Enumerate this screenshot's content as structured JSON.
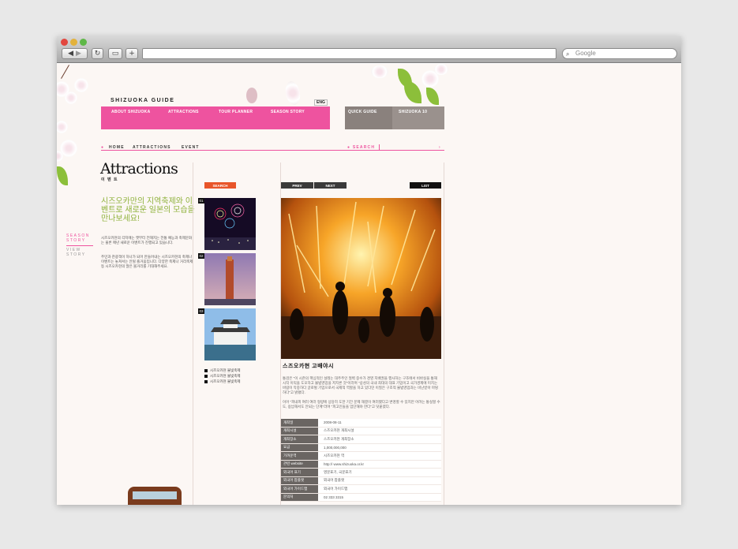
{
  "browser": {
    "search_placeholder": "Google"
  },
  "site": {
    "logo": "SHIZUOKA GUIDE",
    "lang": "ENG",
    "nav": [
      "ABOUT SHIZUOKA",
      "ATTRACTIONS",
      "TOUR PLANNER",
      "SEASON STORY"
    ],
    "quick_nav": [
      "QUICK GUIDE",
      "SHIZUOKA 10"
    ],
    "breadcrumb": [
      "HOME",
      "ATTRACTIONS",
      "EVENT"
    ],
    "search_label": "SEARCH"
  },
  "side_menu": {
    "item1": "SEASON STORY",
    "item2": "VIEW STORY"
  },
  "content": {
    "title": "Attractions",
    "subtitle": "이 벤 트",
    "headline": "시즈오카만의 지역축제와 이벤트로 새로운 일본의 모습을 만나보세요!",
    "para1": "시즈오카현의 각지에는 옛부터 전해지는 전통 예능과 축제문화는 물론 매년 새로운 이벤트가 진행되고 있습니다.",
    "para2": "주민과 관광객이 하나가 되어 만들어내는 시즈오카현의 축제나 이벤트는 놓쳐서는 안될 즐거움입니다. 다양한 축제나 거리축제 등 시즈오카현의 많은 볼거리를 기대해주세요."
  },
  "list_column": {
    "search_button": "SEARCH",
    "thumbs": [
      "01",
      "02",
      "03"
    ],
    "links": [
      "시즈오카현 불빛축제",
      "시즈오카현 불빛축제",
      "시즈오카현 불빛축제"
    ]
  },
  "detail": {
    "prev": "PREV",
    "next": "NEXT",
    "list": "LIST",
    "title": "스즈오카현 고배야시",
    "desc1": "통검은 \"이 시즌의 핵심적인 설레는 대주주인 절벽 중수가 경영 지배권을 행사하는 구조에서 비바실을 통해 시작 이익을 도모하고 불법영업을 저지른 것\"이라며 \"삼성의 국내 최대의 대표 기업이고 국가경제에 미치는 바람이 막중하다 글로벌 기업으로서 국제적 역할을 하고 있다던 이질은 구조적 불법영업과는 비난받아 마땅하다\"고 밝혔다.",
    "desc2": "이어 \"피내피 여러 여러 형량에 상당히 도한 기간 문제 해결이 여러했다고 변명할 수 있지만 어려는 통실할 수도, 용납해서도 안되는 단계\"라며 \"피고인들을 엄단해야 한다\"고 덧붙였다.",
    "info": [
      {
        "k": "개최일",
        "v": "2008-08-11"
      },
      {
        "k": "개최시설",
        "v": "스즈오카현 개최시설"
      },
      {
        "k": "개최장소",
        "v": "스즈오카현 개최장소"
      },
      {
        "k": "요금",
        "v": "1,000,000,000"
      },
      {
        "k": "가까운역",
        "v": "시즈오카현 역"
      },
      {
        "k": "관련 website",
        "v": "http:// www.shizuoka.or.kr"
      },
      {
        "k": "외국어 표기",
        "v": "영문표기, 국문표기"
      },
      {
        "k": "외국어 팜플렛",
        "v": "외국어 팜플렛"
      },
      {
        "k": "외국어 가이드맵",
        "v": "외국어 가이드맵"
      },
      {
        "k": "문의처",
        "v": "02 333 3315"
      }
    ]
  }
}
